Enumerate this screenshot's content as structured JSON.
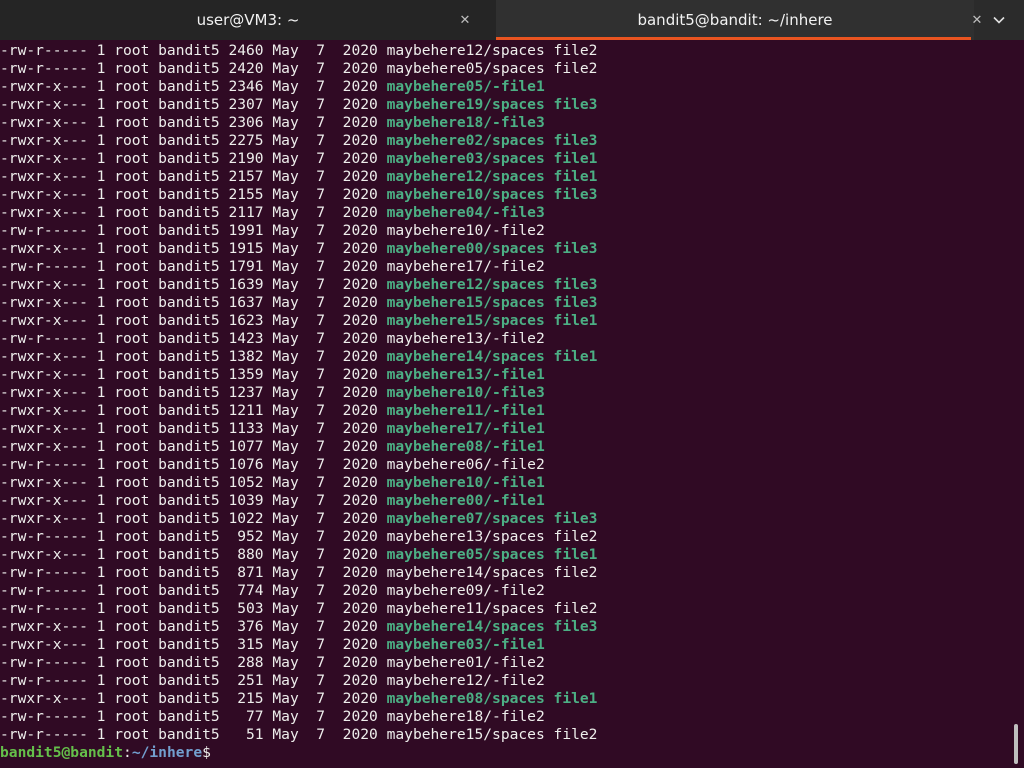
{
  "tabs": [
    {
      "title": "user@VM3: ~",
      "close_icon": "close-icon"
    },
    {
      "title": "bandit5@bandit: ~/inhere",
      "close_icon": "close-icon",
      "active": true
    }
  ],
  "menu_icon": "chevron-down-icon",
  "accent_color": "#e95420",
  "background_color": "#300a24",
  "listing": [
    {
      "perms": "-rw-r-----",
      "links": "1",
      "owner": "root",
      "group": "bandit5",
      "size": "2460",
      "month": "May",
      "day": "7",
      "year": "2020",
      "name": "maybehere12/spaces file2",
      "exec": false
    },
    {
      "perms": "-rw-r-----",
      "links": "1",
      "owner": "root",
      "group": "bandit5",
      "size": "2420",
      "month": "May",
      "day": "7",
      "year": "2020",
      "name": "maybehere05/spaces file2",
      "exec": false
    },
    {
      "perms": "-rwxr-x---",
      "links": "1",
      "owner": "root",
      "group": "bandit5",
      "size": "2346",
      "month": "May",
      "day": "7",
      "year": "2020",
      "name": "maybehere05/-file1",
      "exec": true
    },
    {
      "perms": "-rwxr-x---",
      "links": "1",
      "owner": "root",
      "group": "bandit5",
      "size": "2307",
      "month": "May",
      "day": "7",
      "year": "2020",
      "name": "maybehere19/spaces file3",
      "exec": true
    },
    {
      "perms": "-rwxr-x---",
      "links": "1",
      "owner": "root",
      "group": "bandit5",
      "size": "2306",
      "month": "May",
      "day": "7",
      "year": "2020",
      "name": "maybehere18/-file3",
      "exec": true
    },
    {
      "perms": "-rwxr-x---",
      "links": "1",
      "owner": "root",
      "group": "bandit5",
      "size": "2275",
      "month": "May",
      "day": "7",
      "year": "2020",
      "name": "maybehere02/spaces file3",
      "exec": true
    },
    {
      "perms": "-rwxr-x---",
      "links": "1",
      "owner": "root",
      "group": "bandit5",
      "size": "2190",
      "month": "May",
      "day": "7",
      "year": "2020",
      "name": "maybehere03/spaces file1",
      "exec": true
    },
    {
      "perms": "-rwxr-x---",
      "links": "1",
      "owner": "root",
      "group": "bandit5",
      "size": "2157",
      "month": "May",
      "day": "7",
      "year": "2020",
      "name": "maybehere12/spaces file1",
      "exec": true
    },
    {
      "perms": "-rwxr-x---",
      "links": "1",
      "owner": "root",
      "group": "bandit5",
      "size": "2155",
      "month": "May",
      "day": "7",
      "year": "2020",
      "name": "maybehere10/spaces file3",
      "exec": true
    },
    {
      "perms": "-rwxr-x---",
      "links": "1",
      "owner": "root",
      "group": "bandit5",
      "size": "2117",
      "month": "May",
      "day": "7",
      "year": "2020",
      "name": "maybehere04/-file3",
      "exec": true
    },
    {
      "perms": "-rw-r-----",
      "links": "1",
      "owner": "root",
      "group": "bandit5",
      "size": "1991",
      "month": "May",
      "day": "7",
      "year": "2020",
      "name": "maybehere10/-file2",
      "exec": false
    },
    {
      "perms": "-rwxr-x---",
      "links": "1",
      "owner": "root",
      "group": "bandit5",
      "size": "1915",
      "month": "May",
      "day": "7",
      "year": "2020",
      "name": "maybehere00/spaces file3",
      "exec": true
    },
    {
      "perms": "-rw-r-----",
      "links": "1",
      "owner": "root",
      "group": "bandit5",
      "size": "1791",
      "month": "May",
      "day": "7",
      "year": "2020",
      "name": "maybehere17/-file2",
      "exec": false
    },
    {
      "perms": "-rwxr-x---",
      "links": "1",
      "owner": "root",
      "group": "bandit5",
      "size": "1639",
      "month": "May",
      "day": "7",
      "year": "2020",
      "name": "maybehere12/spaces file3",
      "exec": true
    },
    {
      "perms": "-rwxr-x---",
      "links": "1",
      "owner": "root",
      "group": "bandit5",
      "size": "1637",
      "month": "May",
      "day": "7",
      "year": "2020",
      "name": "maybehere15/spaces file3",
      "exec": true
    },
    {
      "perms": "-rwxr-x---",
      "links": "1",
      "owner": "root",
      "group": "bandit5",
      "size": "1623",
      "month": "May",
      "day": "7",
      "year": "2020",
      "name": "maybehere15/spaces file1",
      "exec": true
    },
    {
      "perms": "-rw-r-----",
      "links": "1",
      "owner": "root",
      "group": "bandit5",
      "size": "1423",
      "month": "May",
      "day": "7",
      "year": "2020",
      "name": "maybehere13/-file2",
      "exec": false
    },
    {
      "perms": "-rwxr-x---",
      "links": "1",
      "owner": "root",
      "group": "bandit5",
      "size": "1382",
      "month": "May",
      "day": "7",
      "year": "2020",
      "name": "maybehere14/spaces file1",
      "exec": true
    },
    {
      "perms": "-rwxr-x---",
      "links": "1",
      "owner": "root",
      "group": "bandit5",
      "size": "1359",
      "month": "May",
      "day": "7",
      "year": "2020",
      "name": "maybehere13/-file1",
      "exec": true
    },
    {
      "perms": "-rwxr-x---",
      "links": "1",
      "owner": "root",
      "group": "bandit5",
      "size": "1237",
      "month": "May",
      "day": "7",
      "year": "2020",
      "name": "maybehere10/-file3",
      "exec": true
    },
    {
      "perms": "-rwxr-x---",
      "links": "1",
      "owner": "root",
      "group": "bandit5",
      "size": "1211",
      "month": "May",
      "day": "7",
      "year": "2020",
      "name": "maybehere11/-file1",
      "exec": true
    },
    {
      "perms": "-rwxr-x---",
      "links": "1",
      "owner": "root",
      "group": "bandit5",
      "size": "1133",
      "month": "May",
      "day": "7",
      "year": "2020",
      "name": "maybehere17/-file1",
      "exec": true
    },
    {
      "perms": "-rwxr-x---",
      "links": "1",
      "owner": "root",
      "group": "bandit5",
      "size": "1077",
      "month": "May",
      "day": "7",
      "year": "2020",
      "name": "maybehere08/-file1",
      "exec": true
    },
    {
      "perms": "-rw-r-----",
      "links": "1",
      "owner": "root",
      "group": "bandit5",
      "size": "1076",
      "month": "May",
      "day": "7",
      "year": "2020",
      "name": "maybehere06/-file2",
      "exec": false
    },
    {
      "perms": "-rwxr-x---",
      "links": "1",
      "owner": "root",
      "group": "bandit5",
      "size": "1052",
      "month": "May",
      "day": "7",
      "year": "2020",
      "name": "maybehere10/-file1",
      "exec": true
    },
    {
      "perms": "-rwxr-x---",
      "links": "1",
      "owner": "root",
      "group": "bandit5",
      "size": "1039",
      "month": "May",
      "day": "7",
      "year": "2020",
      "name": "maybehere00/-file1",
      "exec": true
    },
    {
      "perms": "-rwxr-x---",
      "links": "1",
      "owner": "root",
      "group": "bandit5",
      "size": "1022",
      "month": "May",
      "day": "7",
      "year": "2020",
      "name": "maybehere07/spaces file3",
      "exec": true
    },
    {
      "perms": "-rw-r-----",
      "links": "1",
      "owner": "root",
      "group": "bandit5",
      "size": "952",
      "month": "May",
      "day": "7",
      "year": "2020",
      "name": "maybehere13/spaces file2",
      "exec": false
    },
    {
      "perms": "-rwxr-x---",
      "links": "1",
      "owner": "root",
      "group": "bandit5",
      "size": "880",
      "month": "May",
      "day": "7",
      "year": "2020",
      "name": "maybehere05/spaces file1",
      "exec": true
    },
    {
      "perms": "-rw-r-----",
      "links": "1",
      "owner": "root",
      "group": "bandit5",
      "size": "871",
      "month": "May",
      "day": "7",
      "year": "2020",
      "name": "maybehere14/spaces file2",
      "exec": false
    },
    {
      "perms": "-rw-r-----",
      "links": "1",
      "owner": "root",
      "group": "bandit5",
      "size": "774",
      "month": "May",
      "day": "7",
      "year": "2020",
      "name": "maybehere09/-file2",
      "exec": false
    },
    {
      "perms": "-rw-r-----",
      "links": "1",
      "owner": "root",
      "group": "bandit5",
      "size": "503",
      "month": "May",
      "day": "7",
      "year": "2020",
      "name": "maybehere11/spaces file2",
      "exec": false
    },
    {
      "perms": "-rwxr-x---",
      "links": "1",
      "owner": "root",
      "group": "bandit5",
      "size": "376",
      "month": "May",
      "day": "7",
      "year": "2020",
      "name": "maybehere14/spaces file3",
      "exec": true
    },
    {
      "perms": "-rwxr-x---",
      "links": "1",
      "owner": "root",
      "group": "bandit5",
      "size": "315",
      "month": "May",
      "day": "7",
      "year": "2020",
      "name": "maybehere03/-file1",
      "exec": true
    },
    {
      "perms": "-rw-r-----",
      "links": "1",
      "owner": "root",
      "group": "bandit5",
      "size": "288",
      "month": "May",
      "day": "7",
      "year": "2020",
      "name": "maybehere01/-file2",
      "exec": false
    },
    {
      "perms": "-rw-r-----",
      "links": "1",
      "owner": "root",
      "group": "bandit5",
      "size": "251",
      "month": "May",
      "day": "7",
      "year": "2020",
      "name": "maybehere12/-file2",
      "exec": false
    },
    {
      "perms": "-rwxr-x---",
      "links": "1",
      "owner": "root",
      "group": "bandit5",
      "size": "215",
      "month": "May",
      "day": "7",
      "year": "2020",
      "name": "maybehere08/spaces file1",
      "exec": true
    },
    {
      "perms": "-rw-r-----",
      "links": "1",
      "owner": "root",
      "group": "bandit5",
      "size": "77",
      "month": "May",
      "day": "7",
      "year": "2020",
      "name": "maybehere18/-file2",
      "exec": false
    },
    {
      "perms": "-rw-r-----",
      "links": "1",
      "owner": "root",
      "group": "bandit5",
      "size": "51",
      "month": "May",
      "day": "7",
      "year": "2020",
      "name": "maybehere15/spaces file2",
      "exec": false
    }
  ],
  "prompt": {
    "user_host": "bandit5@bandit",
    "separator": ":",
    "path": "~/inhere",
    "symbol": "$"
  }
}
